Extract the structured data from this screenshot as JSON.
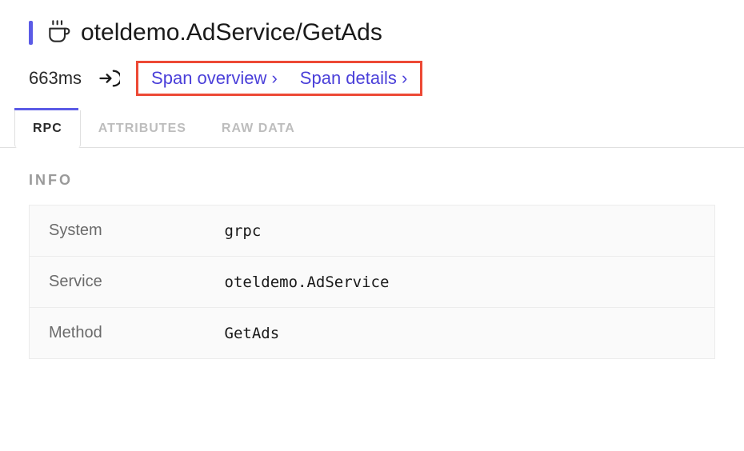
{
  "header": {
    "title": "oteldemo.AdService/GetAds",
    "duration": "663ms",
    "links": {
      "span_overview": "Span overview ›",
      "span_details": "Span details ›"
    }
  },
  "tabs": {
    "rpc": "RPC",
    "attributes": "ATTRIBUTES",
    "raw_data": "RAW DATA"
  },
  "section": {
    "heading": "INFO",
    "rows": [
      {
        "label": "System",
        "value": "grpc"
      },
      {
        "label": "Service",
        "value": "oteldemo.AdService"
      },
      {
        "label": "Method",
        "value": "GetAds"
      }
    ]
  }
}
